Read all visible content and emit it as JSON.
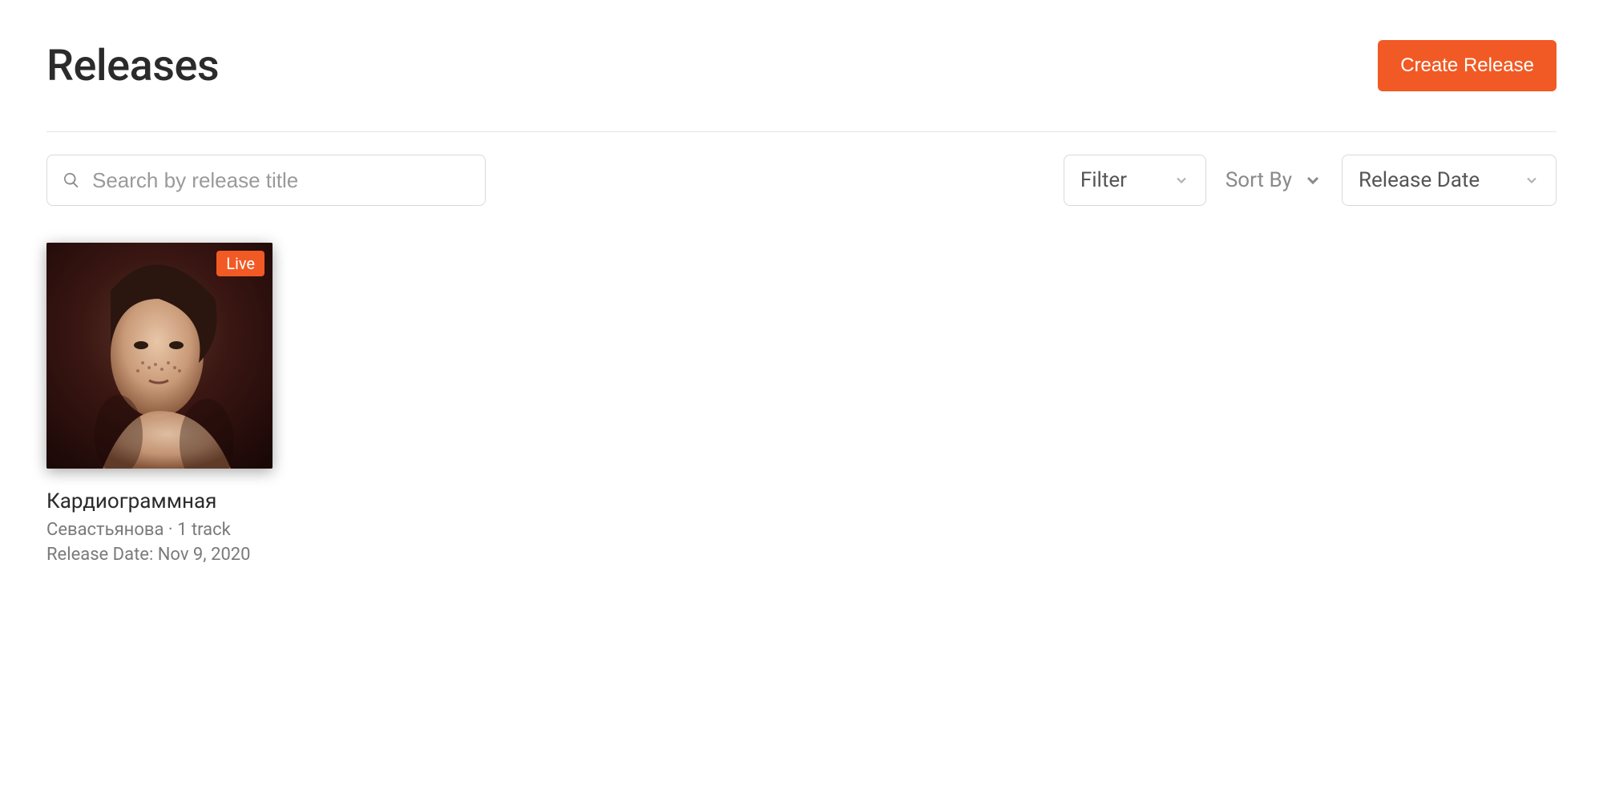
{
  "header": {
    "title": "Releases",
    "create_label": "Create Release"
  },
  "controls": {
    "search_placeholder": "Search by release title",
    "filter_label": "Filter",
    "sort_label": "Sort By",
    "sort_value": "Release Date"
  },
  "releases": [
    {
      "title": "Кардиограммная",
      "artist": "Севастьянова",
      "track_count_label": "1 track",
      "release_date_label": "Release Date: Nov 9, 2020",
      "status": "Live"
    }
  ],
  "colors": {
    "accent": "#f15a24"
  }
}
